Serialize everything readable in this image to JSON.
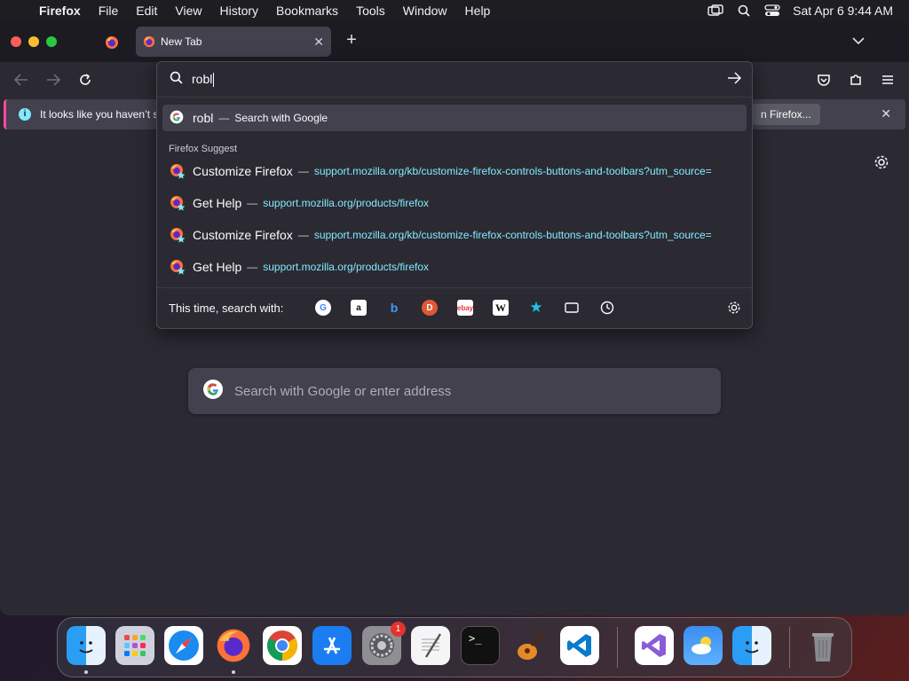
{
  "menubar": {
    "items": [
      "Firefox",
      "File",
      "Edit",
      "View",
      "History",
      "Bookmarks",
      "Tools",
      "Window",
      "Help"
    ],
    "clock": "Sat Apr 6  9:44 AM"
  },
  "tabs": {
    "active_title": "New Tab"
  },
  "notification": {
    "text": "It looks like you haven’t st",
    "button": "n Firefox..."
  },
  "urlbar": {
    "typed": "robl",
    "google_result": {
      "query": "robl",
      "sep": "—",
      "label": "Search with Google"
    },
    "suggest_header": "Firefox Suggest",
    "suggestions": [
      {
        "title": "Customize Firefox",
        "sep": "—",
        "url": "support.mozilla.org/kb/customize-firefox-controls-buttons-and-toolbars?utm_source="
      },
      {
        "title": "Get Help",
        "sep": "—",
        "url": "support.mozilla.org/products/firefox"
      },
      {
        "title": "Customize Firefox",
        "sep": "—",
        "url": "support.mozilla.org/kb/customize-firefox-controls-buttons-and-toolbars?utm_source="
      },
      {
        "title": "Get Help",
        "sep": "—",
        "url": "support.mozilla.org/products/firefox"
      }
    ],
    "oneoff_label": "This time, search with:",
    "engines": [
      "google-icon",
      "amazon-icon",
      "bing-icon",
      "duckduckgo-icon",
      "ebay-icon",
      "wikipedia-icon",
      "bookmarks-icon",
      "tabs-icon",
      "history-icon"
    ]
  },
  "newtab": {
    "search_placeholder": "Search with Google or enter address"
  },
  "dock": {
    "apps": [
      "finder",
      "launchpad",
      "safari",
      "firefox",
      "chrome",
      "app-store",
      "system-settings",
      "textedit",
      "terminal",
      "garageband",
      "vscode",
      "visual-studio",
      "weather",
      "finder-alt",
      "trash"
    ],
    "settings_badge": "1"
  },
  "colors": {
    "accent": "#80ebff",
    "window_bg": "#2b2a33",
    "panel_bg": "#42414d",
    "notif_accent": "#ff4aa2"
  }
}
